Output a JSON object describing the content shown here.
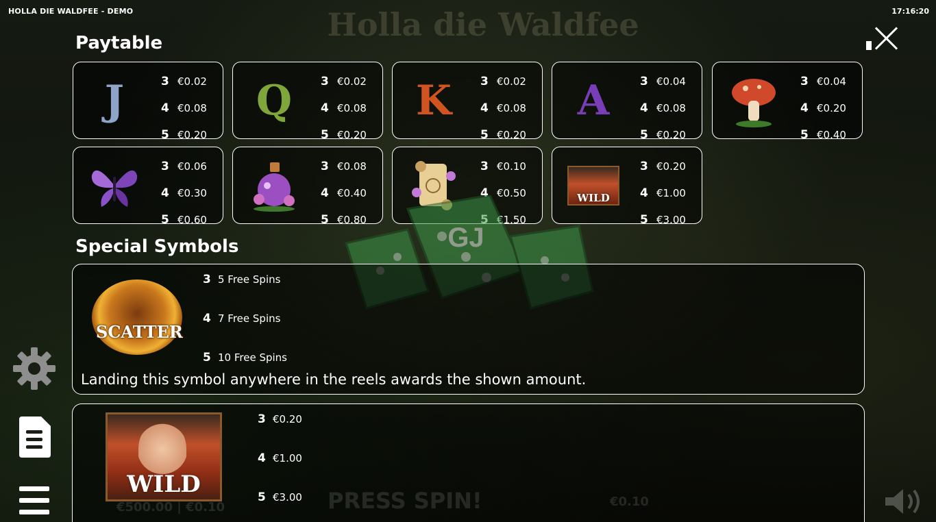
{
  "window": {
    "title": "HOLLA DIE WALDFEE - DEMO",
    "clock": "17:16:20"
  },
  "background": {
    "logo": "Holla die Waldfee",
    "press_spin": "PRESS SPIN!",
    "bet": "€0.10",
    "balance": "€500.00 | €0.10"
  },
  "paytable": {
    "title": "Paytable",
    "symbols": [
      {
        "icon": "j-icon",
        "glyph": "J",
        "color": "#8ea4c8",
        "pays": [
          [
            "3",
            "€0.02"
          ],
          [
            "4",
            "€0.08"
          ],
          [
            "5",
            "€0.20"
          ]
        ]
      },
      {
        "icon": "q-icon",
        "glyph": "Q",
        "color": "#7fa63a",
        "pays": [
          [
            "3",
            "€0.02"
          ],
          [
            "4",
            "€0.08"
          ],
          [
            "5",
            "€0.20"
          ]
        ]
      },
      {
        "icon": "k-icon",
        "glyph": "K",
        "color": "#d0541f",
        "pays": [
          [
            "3",
            "€0.02"
          ],
          [
            "4",
            "€0.08"
          ],
          [
            "5",
            "€0.20"
          ]
        ]
      },
      {
        "icon": "a-icon",
        "glyph": "A",
        "color": "#7a3db8",
        "pays": [
          [
            "3",
            "€0.04"
          ],
          [
            "4",
            "€0.08"
          ],
          [
            "5",
            "€0.20"
          ]
        ]
      },
      {
        "icon": "mushroom-icon",
        "glyph": "",
        "color": "#d0492a",
        "pays": [
          [
            "3",
            "€0.04"
          ],
          [
            "4",
            "€0.20"
          ],
          [
            "5",
            "€0.40"
          ]
        ]
      },
      {
        "icon": "butterfly-icon",
        "glyph": "",
        "color": "#a56ad8",
        "pays": [
          [
            "3",
            "€0.06"
          ],
          [
            "4",
            "€0.30"
          ],
          [
            "5",
            "€0.60"
          ]
        ]
      },
      {
        "icon": "potion-icon",
        "glyph": "",
        "color": "#9b4fc0",
        "pays": [
          [
            "3",
            "€0.08"
          ],
          [
            "4",
            "€0.40"
          ],
          [
            "5",
            "€0.80"
          ]
        ]
      },
      {
        "icon": "scroll-icon",
        "glyph": "",
        "color": "#e8cf95",
        "pays": [
          [
            "3",
            "€0.10"
          ],
          [
            "4",
            "€0.50"
          ],
          [
            "5",
            "€1.50"
          ]
        ]
      },
      {
        "icon": "wild-icon",
        "glyph": "WILD",
        "color": "#c0502a",
        "pays": [
          [
            "3",
            "€0.20"
          ],
          [
            "4",
            "€1.00"
          ],
          [
            "5",
            "€3.00"
          ]
        ]
      }
    ]
  },
  "special": {
    "title": "Special Symbols",
    "scatter": {
      "label": "SCATTER",
      "rows": [
        [
          "3",
          "5 Free Spins"
        ],
        [
          "4",
          "7 Free Spins"
        ],
        [
          "5",
          "10 Free Spins"
        ]
      ],
      "description": "Landing this symbol anywhere in the reels awards the shown amount."
    },
    "wild": {
      "label": "WILD",
      "rows": [
        [
          "3",
          "€0.20"
        ],
        [
          "4",
          "€1.00"
        ],
        [
          "5",
          "€3.00"
        ]
      ]
    }
  },
  "colors": {
    "border": "#ffffff",
    "card_bg": "rgba(0,0,0,0.55)",
    "watermark": "#3f9a4a"
  }
}
